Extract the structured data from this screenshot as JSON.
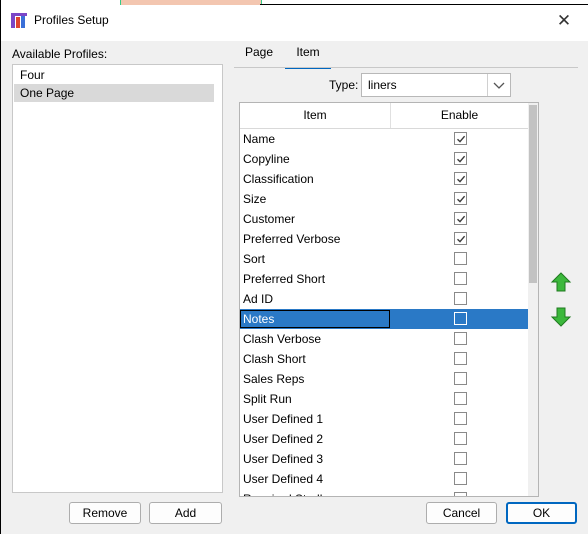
{
  "window": {
    "title": "Profiles Setup",
    "close_glyph": "✕"
  },
  "left_panel": {
    "label": "Available Profiles:",
    "profiles": [
      {
        "label": "Four",
        "selected": false
      },
      {
        "label": "One Page",
        "selected": true
      }
    ],
    "remove_label": "Remove",
    "add_label": "Add"
  },
  "tabs": [
    {
      "label": "Page",
      "active": false
    },
    {
      "label": "Item",
      "active": true
    }
  ],
  "type_field": {
    "label": "Type:",
    "value": "liners"
  },
  "grid": {
    "columns": [
      "Item",
      "Enable"
    ],
    "rows": [
      {
        "name": "Name",
        "enabled": true
      },
      {
        "name": "Copyline",
        "enabled": true
      },
      {
        "name": "Classification",
        "enabled": true
      },
      {
        "name": "Size",
        "enabled": true
      },
      {
        "name": "Customer",
        "enabled": true
      },
      {
        "name": "Preferred Verbose",
        "enabled": true
      },
      {
        "name": "Sort",
        "enabled": false
      },
      {
        "name": "Preferred Short",
        "enabled": false
      },
      {
        "name": "Ad ID",
        "enabled": false
      },
      {
        "name": "Notes",
        "enabled": false,
        "selected": true
      },
      {
        "name": "Clash Verbose",
        "enabled": false
      },
      {
        "name": "Clash Short",
        "enabled": false
      },
      {
        "name": "Sales Reps",
        "enabled": false
      },
      {
        "name": "Split Run",
        "enabled": false
      },
      {
        "name": "User Defined 1",
        "enabled": false
      },
      {
        "name": "User Defined 2",
        "enabled": false
      },
      {
        "name": "User Defined 3",
        "enabled": false
      },
      {
        "name": "User Defined 4",
        "enabled": false
      },
      {
        "name": "Required Stroll",
        "enabled": false
      }
    ]
  },
  "footer": {
    "cancel_label": "Cancel",
    "ok_label": "OK"
  },
  "colors": {
    "accent": "#0067c0",
    "selection": "#2a79c6",
    "arrow_green": "#3cb83c"
  }
}
